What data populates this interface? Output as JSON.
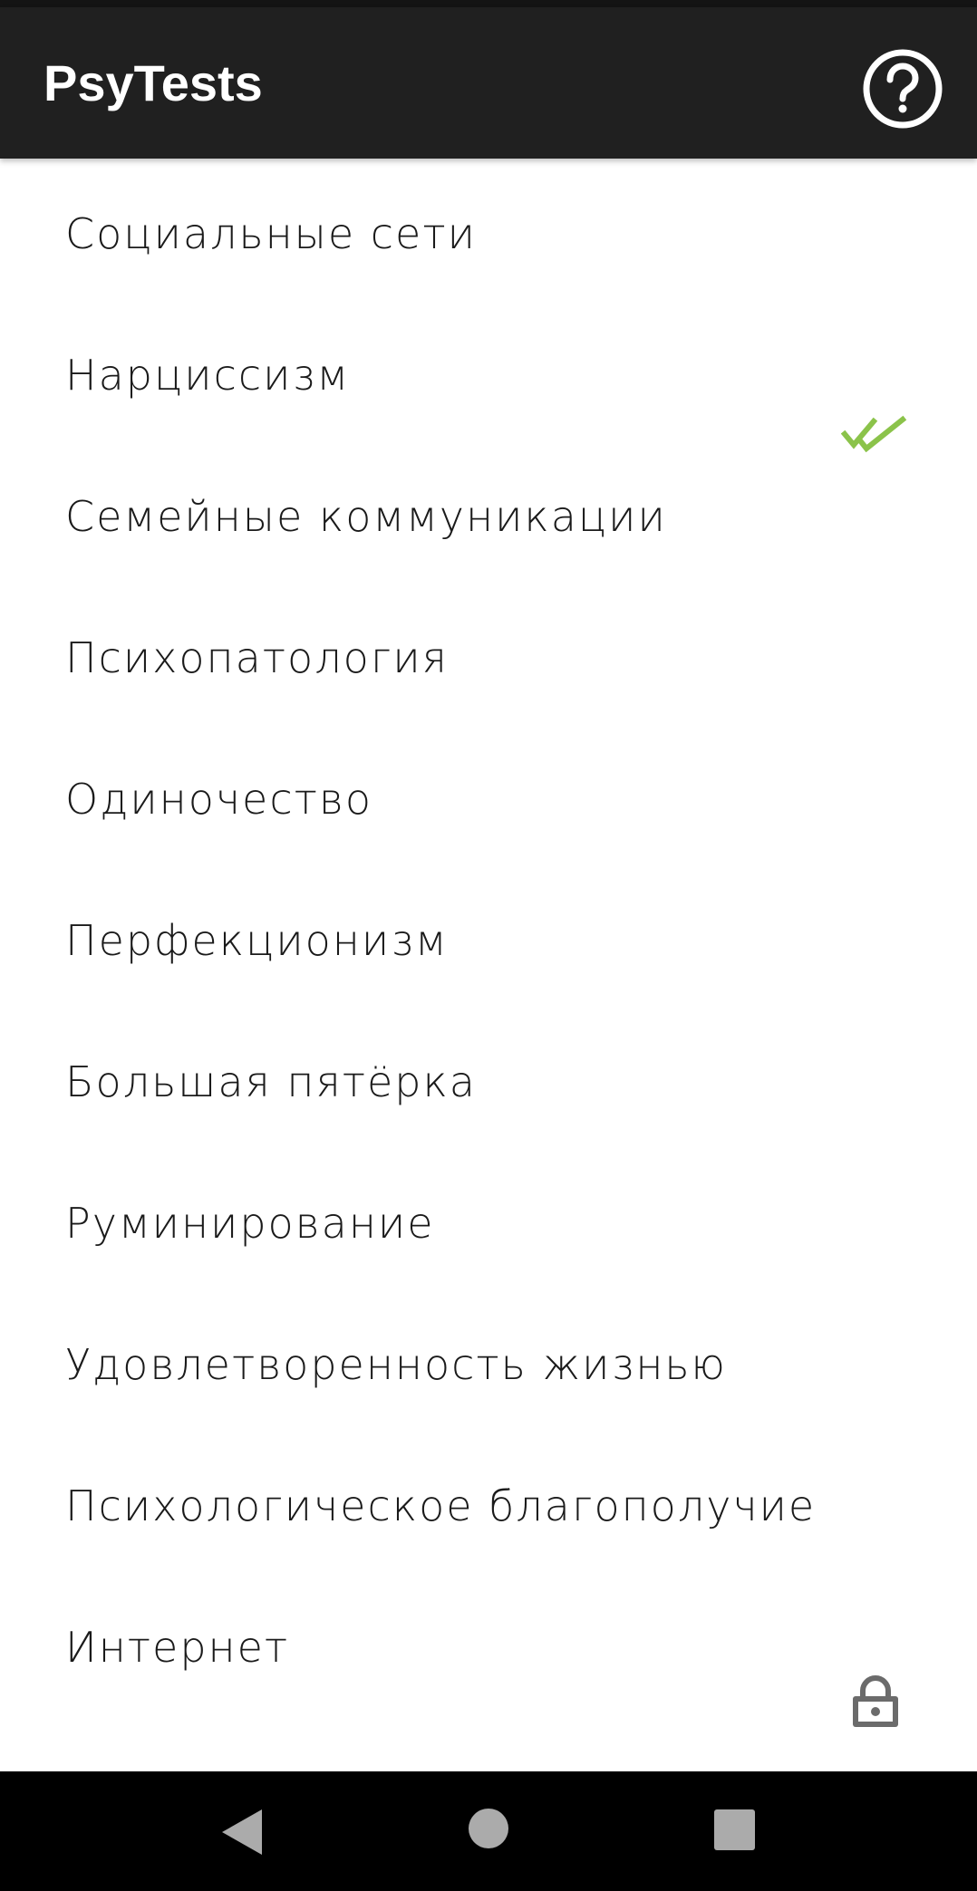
{
  "app_bar": {
    "title": "PsyTests",
    "help_icon": "help-circle-icon"
  },
  "tests": [
    {
      "label": "Социальные сети"
    },
    {
      "label": "Нарциссизм"
    },
    {
      "label": "Семейные коммуникации"
    },
    {
      "label": "Психопатология"
    },
    {
      "label": "Одиночество"
    },
    {
      "label": "Перфекционизм"
    },
    {
      "label": "Большая пятёрка"
    },
    {
      "label": "Руминирование"
    },
    {
      "label": "Удовлетворенность жизнью"
    },
    {
      "label": "Психологическое благополучие"
    },
    {
      "label": "Интернет"
    }
  ],
  "status_icons": {
    "completed": "double-check-icon",
    "locked": "lock-icon"
  },
  "colors": {
    "app_bar": "#202020",
    "completed_check": "#8bc34a",
    "lock": "#6b6b6b",
    "nav_bar": "#000000"
  },
  "nav": {
    "back": "back-triangle-icon",
    "home": "home-circle-icon",
    "recents": "recents-square-icon"
  }
}
